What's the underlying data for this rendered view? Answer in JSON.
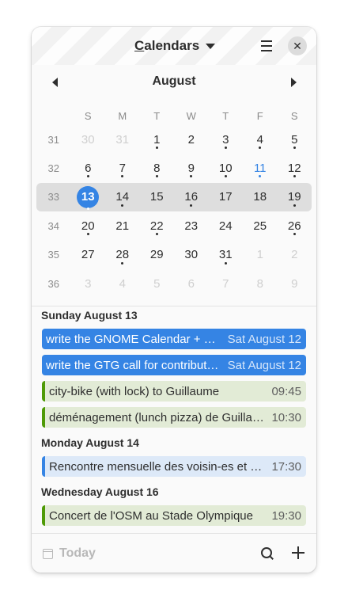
{
  "header": {
    "title": "Calendars",
    "mnemonic": "C",
    "title_rest": "alendars"
  },
  "month_nav": {
    "month": "August"
  },
  "calendar": {
    "weekdays": [
      "S",
      "M",
      "T",
      "W",
      "T",
      "F",
      "S"
    ],
    "weeks": [
      {
        "week": "31",
        "days": [
          {
            "d": "30",
            "out": true
          },
          {
            "d": "31",
            "out": true
          },
          {
            "d": "1",
            "dot": true
          },
          {
            "d": "2"
          },
          {
            "d": "3",
            "dot": true
          },
          {
            "d": "4",
            "dot": true
          },
          {
            "d": "5",
            "dot": true
          }
        ]
      },
      {
        "week": "32",
        "days": [
          {
            "d": "6",
            "dot": true
          },
          {
            "d": "7",
            "dot": true
          },
          {
            "d": "8",
            "dot": true
          },
          {
            "d": "9",
            "dot": true
          },
          {
            "d": "10",
            "dot": true
          },
          {
            "d": "11",
            "accent": true,
            "dot": true
          },
          {
            "d": "12",
            "dot": true
          }
        ]
      },
      {
        "week": "33",
        "current": true,
        "days": [
          {
            "d": "13",
            "today": true,
            "dot": true
          },
          {
            "d": "14",
            "dot": true
          },
          {
            "d": "15"
          },
          {
            "d": "16",
            "dot": true
          },
          {
            "d": "17"
          },
          {
            "d": "18"
          },
          {
            "d": "19",
            "dot": true
          }
        ]
      },
      {
        "week": "34",
        "days": [
          {
            "d": "20",
            "dot": true
          },
          {
            "d": "21"
          },
          {
            "d": "22",
            "dot": true
          },
          {
            "d": "23"
          },
          {
            "d": "24"
          },
          {
            "d": "25"
          },
          {
            "d": "26",
            "dot": true
          }
        ]
      },
      {
        "week": "35",
        "days": [
          {
            "d": "27"
          },
          {
            "d": "28",
            "dot": true
          },
          {
            "d": "29"
          },
          {
            "d": "30"
          },
          {
            "d": "31",
            "dot": true
          },
          {
            "d": "1",
            "out": true
          },
          {
            "d": "2",
            "out": true
          }
        ]
      },
      {
        "week": "36",
        "days": [
          {
            "d": "3",
            "out": true
          },
          {
            "d": "4",
            "out": true
          },
          {
            "d": "5",
            "out": true
          },
          {
            "d": "6",
            "out": true
          },
          {
            "d": "7",
            "out": true
          },
          {
            "d": "8",
            "out": true
          },
          {
            "d": "9",
            "out": true
          }
        ]
      }
    ]
  },
  "agenda": {
    "groups": [
      {
        "date": "Sunday August 13",
        "events": [
          {
            "title": "write the GNOME Calendar + Ev…",
            "time": "Sat August 12",
            "style": "allday"
          },
          {
            "title": "write the GTG call for contributi…",
            "time": "Sat August 12",
            "style": "allday"
          },
          {
            "title": "city-bike (with lock) to Guillaume",
            "time": "09:45",
            "style": "green"
          },
          {
            "title": "déménagement (lunch pizza) de Guillau…",
            "time": "10:30",
            "style": "green"
          }
        ]
      },
      {
        "date": "Monday August 14",
        "events": [
          {
            "title": "Rencontre mensuelle des voisin-es et c…",
            "time": "17:30",
            "style": "blue"
          }
        ]
      },
      {
        "date": "Wednesday August 16",
        "events": [
          {
            "title": "Concert de l'OSM au Stade Olympique",
            "time": "19:30",
            "style": "green"
          }
        ]
      }
    ]
  },
  "bottom_bar": {
    "today_label": "Today"
  },
  "colors": {
    "accent": "#3584e4",
    "green": "#4e9a06",
    "green_bg": "#e2ebd6",
    "blue_bg": "#dde9f8"
  },
  "icons": {
    "menu": "hamburger-icon",
    "close": "close-icon",
    "search": "search-icon",
    "add": "add-icon",
    "today": "calendar-icon",
    "prev": "chevron-left-icon",
    "next": "chevron-right-icon",
    "dropdown": "caret-down-icon"
  }
}
